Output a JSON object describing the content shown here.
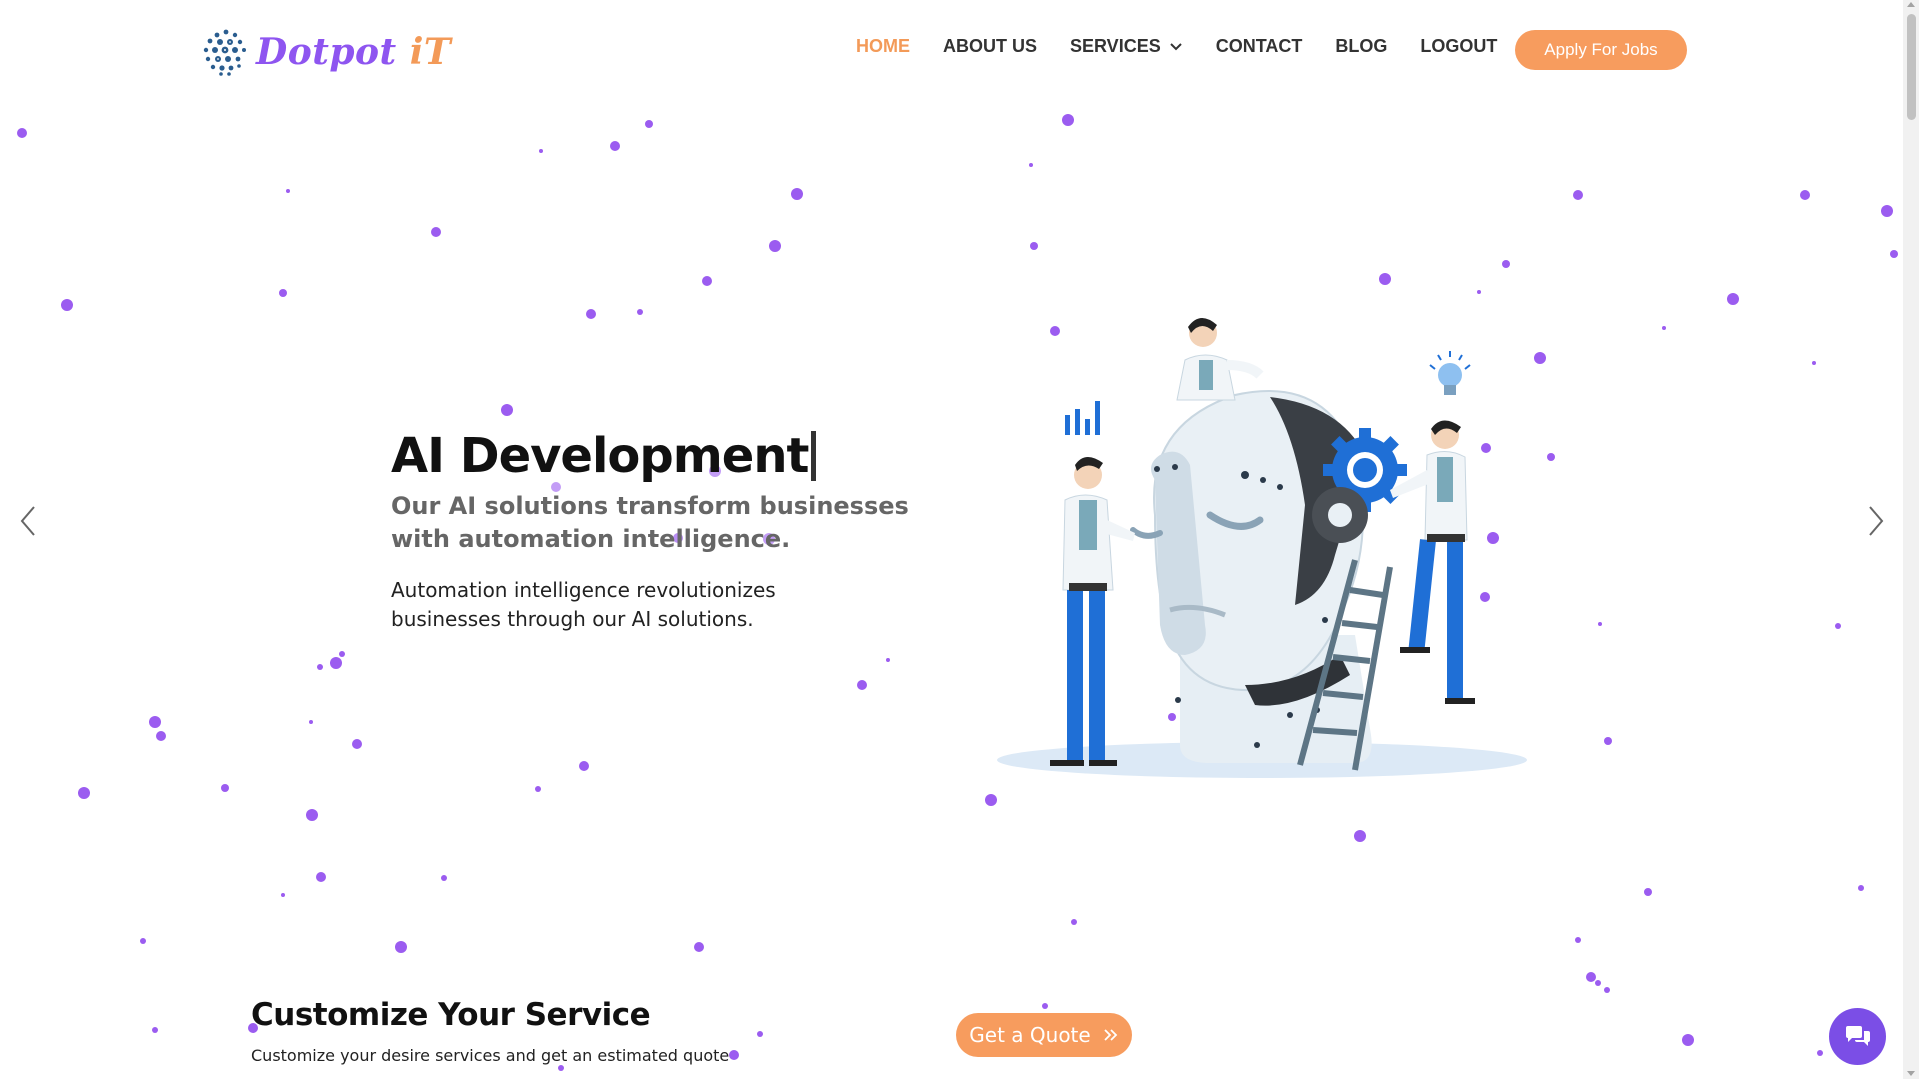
{
  "header": {
    "logo": {
      "name_main": "Dotpot",
      "name_accent": "iT"
    },
    "nav": [
      {
        "label": "HOME",
        "active": true
      },
      {
        "label": "ABOUT US",
        "active": false
      },
      {
        "label": "SERVICES",
        "active": false,
        "has_dropdown": true
      },
      {
        "label": "CONTACT",
        "active": false
      },
      {
        "label": "BLOG",
        "active": false
      },
      {
        "label": "LOGOUT",
        "active": false
      }
    ],
    "apply_button": "Apply For Jobs"
  },
  "hero": {
    "title": "AI Development",
    "subtitle": "Our AI solutions transform businesses with automation intelligence.",
    "description": "Automation intelligence revolutionizes businesses through our AI solutions.",
    "prev_icon": "chevron-left-icon",
    "next_icon": "chevron-right-icon"
  },
  "customize": {
    "title": "Customize Your Service",
    "subtitle": "Customize your desire services and get an estimated quote",
    "quote_button": "Get a Quote",
    "quote_icon": "double-chevron-right-icon"
  },
  "chat": {
    "icon": "chat-bubbles-icon"
  },
  "colors": {
    "accent_orange": "#f79c5e",
    "nav_active": "#f39a58",
    "brand_purple": "#8e55f0",
    "particle": "#9b5cf0",
    "chat_purple": "#7b4ee6"
  }
}
